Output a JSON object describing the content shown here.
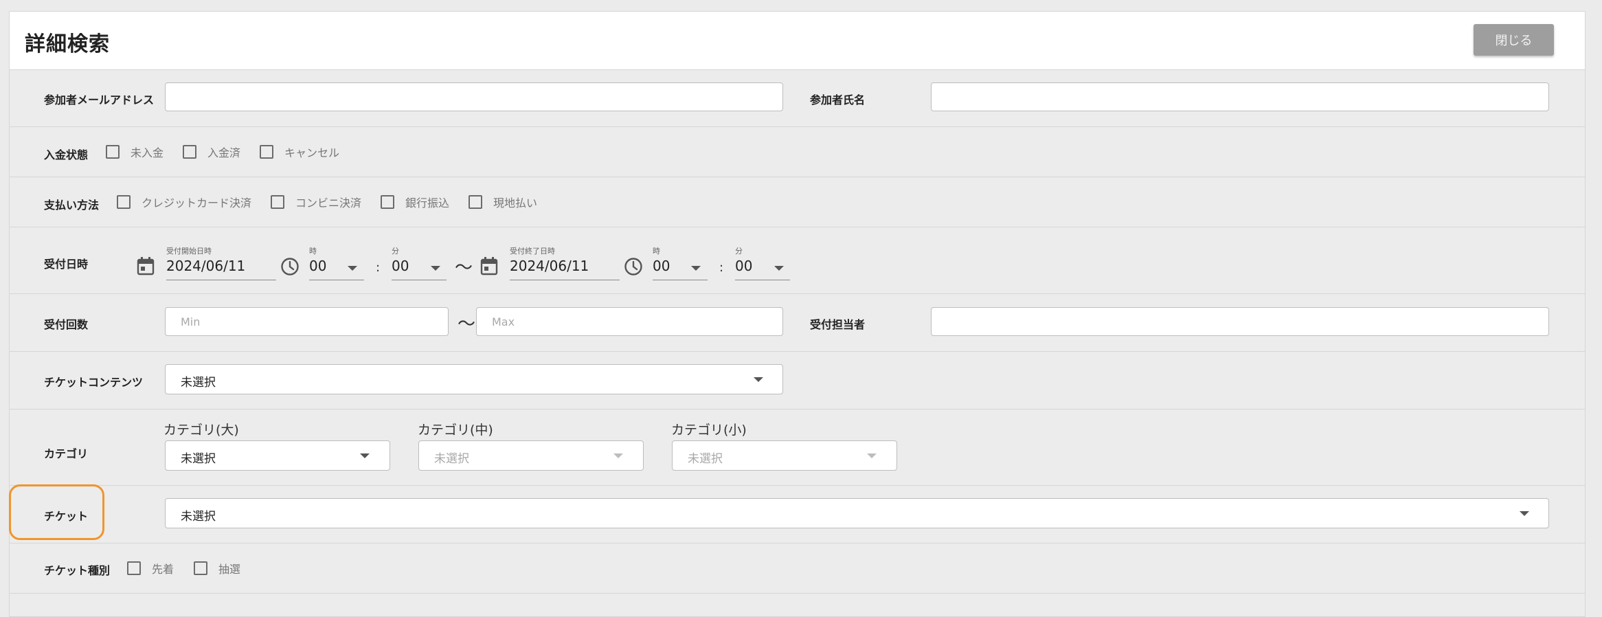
{
  "header": {
    "title": "詳細検索",
    "close_label": "閉じる"
  },
  "email_row": {
    "label": "参加者メールアドレス",
    "value": "",
    "name_label": "参加者氏名",
    "name_value": ""
  },
  "payment_status": {
    "label": "入金状態",
    "options": [
      "未入金",
      "入金済",
      "キャンセル"
    ]
  },
  "payment_method": {
    "label": "支払い方法",
    "options": [
      "クレジットカード決済",
      "コンビニ決済",
      "銀行振込",
      "現地払い"
    ]
  },
  "reception_datetime": {
    "label": "受付日時",
    "start": {
      "date_label": "受付開始日時",
      "date": "2024/06/11",
      "hour_label": "時",
      "hour": "00",
      "minute_label": "分",
      "minute": "00"
    },
    "end": {
      "date_label": "受付終了日時",
      "date": "2024/06/11",
      "hour_label": "時",
      "hour": "00",
      "minute_label": "分",
      "minute": "00"
    },
    "colon": ":",
    "tilde": "〜"
  },
  "reception_count": {
    "label": "受付回数",
    "min_placeholder": "Min",
    "max_placeholder": "Max",
    "tilde": "〜",
    "staff_label": "受付担当者",
    "staff_value": ""
  },
  "ticket_contents": {
    "label": "チケットコンテンツ",
    "value": "未選択"
  },
  "category": {
    "label": "カテゴリ",
    "large": {
      "label": "カテゴリ(大)",
      "value": "未選択"
    },
    "medium": {
      "label": "カテゴリ(中)",
      "value": "未選択"
    },
    "small": {
      "label": "カテゴリ(小)",
      "value": "未選択"
    }
  },
  "ticket": {
    "label": "チケット",
    "value": "未選択"
  },
  "ticket_type": {
    "label": "チケット種別",
    "options": [
      "先着",
      "抽選"
    ]
  },
  "colors": {
    "highlight": "#f0952f",
    "close_button": "#9e9e9e"
  },
  "icons": [
    "calendar-icon",
    "clock-icon",
    "chevron-down-icon"
  ]
}
